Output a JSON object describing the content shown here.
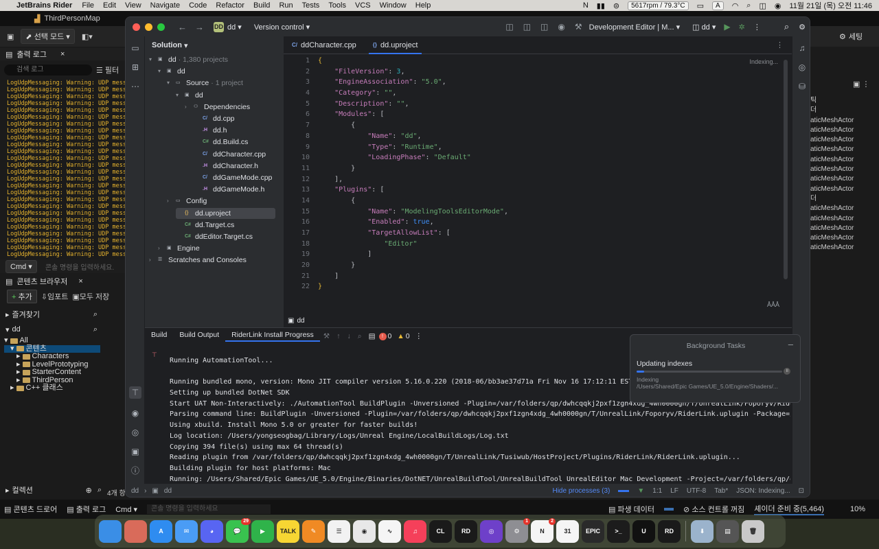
{
  "menubar": {
    "app": "JetBrains Rider",
    "items": [
      "File",
      "Edit",
      "View",
      "Navigate",
      "Code",
      "Refactor",
      "Build",
      "Run",
      "Tests",
      "Tools",
      "VCS",
      "Window",
      "Help"
    ],
    "status": "5617rpm / 79.3°C",
    "clock": "11월 21일 (목) 오전 11:46",
    "input_badge": "A"
  },
  "unreal": {
    "map_title": "ThirdPersonMap",
    "mode_button": "선택 모드",
    "output_log_tab": "출력 로그",
    "search_placeholder": "검색 로그",
    "filter_label": "필터",
    "log_line": "LogUdpMessaging: Warning: UDP mess",
    "cmd_label": "Cmd",
    "cmd_placeholder": "콘솔 명령을 입력하세요.",
    "content_browser_tab": "콘텐츠 브라우저",
    "add_button": "추가",
    "import_button": "임포트",
    "save_all_button": "모두 저장",
    "favorites_label": "즐겨찾기",
    "project_label": "dd",
    "tree": [
      {
        "label": "All",
        "depth": 0,
        "sel": false
      },
      {
        "label": "콘텐츠",
        "depth": 1,
        "sel": true
      },
      {
        "label": "Characters",
        "depth": 2,
        "sel": false
      },
      {
        "label": "LevelPrototyping",
        "depth": 2,
        "sel": false
      },
      {
        "label": "StarterContent",
        "depth": 2,
        "sel": false
      },
      {
        "label": "ThirdPerson",
        "depth": 2,
        "sel": false
      },
      {
        "label": "C++ 클래스",
        "depth": 1,
        "sel": false
      }
    ],
    "collections_label": "컬렉션",
    "items_count": "4개 항",
    "settings_label": "세팅",
    "right_items": [
      "틱",
      "더",
      "aticMeshActor",
      "aticMeshActor",
      "aticMeshActor",
      "aticMeshActor",
      "aticMeshActor",
      "aticMeshActor",
      "aticMeshActor",
      "aticMeshActor",
      "더",
      "aticMeshActor",
      "aticMeshActor",
      "aticMeshActor",
      "aticMeshActor",
      "aticMeshActor"
    ],
    "bottom_bar": {
      "content_drawer": "콘텐츠 드로어",
      "output_log": "출력 로그",
      "cmd": "Cmd",
      "cmd_placeholder": "콘솔 명령을 입력하세요",
      "derived_data": "파생 데이터",
      "source_control": "소스 컨트롤 꺼짐",
      "shader_status": "셰이더 준비 중(5,464)",
      "zoom": "10%"
    }
  },
  "rider": {
    "project_badge": "DD",
    "project_name": "dd",
    "vcs_label": "Version control",
    "run_config": "Development Editor | M...",
    "run_target": "dd",
    "solution_header": "Solution",
    "tree": [
      {
        "label": "dd",
        "muted": "· 1,380 projects",
        "depth": 0,
        "arrow": "▾",
        "icon": "▣",
        "sel": false
      },
      {
        "label": "dd",
        "muted": "",
        "depth": 1,
        "arrow": "▾",
        "icon": "▣",
        "sel": false
      },
      {
        "label": "Source",
        "muted": "· 1 project",
        "depth": 2,
        "arrow": "▾",
        "icon": "▭",
        "sel": false
      },
      {
        "label": "dd",
        "muted": "",
        "depth": 3,
        "arrow": "▾",
        "icon": "▣",
        "sel": false
      },
      {
        "label": "Dependencies",
        "muted": "",
        "depth": 4,
        "arrow": "›",
        "icon": "⚇",
        "sel": false
      },
      {
        "label": "dd.cpp",
        "muted": "",
        "depth": 5,
        "arrow": "",
        "icon": "C/",
        "sel": false
      },
      {
        "label": "dd.h",
        "muted": "",
        "depth": 5,
        "arrow": "",
        "icon": ".H",
        "sel": false
      },
      {
        "label": "dd.Build.cs",
        "muted": "",
        "depth": 5,
        "arrow": "",
        "icon": "C#",
        "sel": false
      },
      {
        "label": "ddCharacter.cpp",
        "muted": "",
        "depth": 5,
        "arrow": "",
        "icon": "C/",
        "sel": false
      },
      {
        "label": "ddCharacter.h",
        "muted": "",
        "depth": 5,
        "arrow": "",
        "icon": ".H",
        "sel": false
      },
      {
        "label": "ddGameMode.cpp",
        "muted": "",
        "depth": 5,
        "arrow": "",
        "icon": "C/",
        "sel": false
      },
      {
        "label": "ddGameMode.h",
        "muted": "",
        "depth": 5,
        "arrow": "",
        "icon": ".H",
        "sel": false
      },
      {
        "label": "Config",
        "muted": "",
        "depth": 2,
        "arrow": "›",
        "icon": "▭",
        "sel": false
      },
      {
        "label": "dd.uproject",
        "muted": "",
        "depth": 3,
        "arrow": "",
        "icon": "{}",
        "sel": true
      },
      {
        "label": "dd.Target.cs",
        "muted": "",
        "depth": 3,
        "arrow": "",
        "icon": "C#",
        "sel": false
      },
      {
        "label": "ddEditor.Target.cs",
        "muted": "",
        "depth": 3,
        "arrow": "",
        "icon": "C#",
        "sel": false
      },
      {
        "label": "Engine",
        "muted": "",
        "depth": 1,
        "arrow": "›",
        "icon": "▣",
        "sel": false
      },
      {
        "label": "Scratches and Consoles",
        "muted": "",
        "depth": 0,
        "arrow": "›",
        "icon": "☰",
        "sel": false
      }
    ],
    "tabs": [
      {
        "label": "ddCharacter.cpp",
        "icon": "C/",
        "active": false
      },
      {
        "label": "dd.uproject",
        "icon": "{}",
        "active": true
      }
    ],
    "indexing_label": "Indexing...",
    "code_lines": [
      "{",
      "    <k>\"FileVersion\"</k>: <n>3</n>,",
      "    <k>\"EngineAssociation\"</k>: <s>\"5.0\"</s>,",
      "    <k>\"Category\"</k>: <s>\"\"</s>,",
      "    <k>\"Description\"</k>: <s>\"\"</s>,",
      "    <k>\"Modules\"</k>: [",
      "        {",
      "            <k>\"Name\"</k>: <s>\"dd\"</s>,",
      "            <k>\"Type\"</k>: <s>\"Runtime\"</s>,",
      "            <k>\"LoadingPhase\"</k>: <s>\"Default\"</s>",
      "        }",
      "    ],",
      "    <k>\"Plugins\"</k>: [",
      "        {",
      "            <k>\"Name\"</k>: <s>\"ModelingToolsEditorMode\"</s>,",
      "            <k>\"Enabled\"</k>: <b>true</b>,",
      "            <k>\"TargetAllowList\"</k>: [",
      "                <s>\"Editor\"</s>",
      "            ]",
      "        }",
      "    ]",
      "}"
    ],
    "breadcrumb": "dd",
    "bottom_tabs": [
      "Build",
      "Build Output",
      "RiderLink Install Progress"
    ],
    "active_bottom_tab": 2,
    "error_count": "0",
    "warning_count": "0",
    "output_lines": [
      "Running AutomationTool...",
      "",
      "Running bundled mono, version: Mono JIT compiler version 5.16.0.220 (2018-06/bb3ae37d71a Fri Nov 16 17:12:11 EST 2018)",
      "Setting up bundled DotNet SDK",
      "Start UAT Non-Interactively: ./AutomationTool BuildPlugin -Unversioned -Plugin=/var/folders/qp/dwhcqqkj2pxf1zgn4xdg_4wh0000gn/T/UnrealLink/Foporyv/RiderLink.uplugin",
      "Parsing command line: BuildPlugin -Unversioned -Plugin=/var/folders/qp/dwhcqqkj2pxf1zgn4xdg_4wh0000gn/T/UnrealLink/Foporyv/RiderLink.uplugin -Package=/var/folders/",
      "Using xbuild. Install Mono 5.0 or greater for faster builds!",
      "Log location: /Users/yongseogbag/Library/Logs/Unreal Engine/LocalBuildLogs/Log.txt",
      "Copying 394 file(s) using max 64 thread(s)",
      "Reading plugin from /var/folders/qp/dwhcqqkj2pxf1zgn4xdg_4wh0000gn/T/UnrealLink/Tusiwub/HostProject/Plugins/RiderLink/RiderLink.uplugin...",
      "Building plugin for host platforms: Mac",
      "Running: /Users/Shared/Epic Games/UE_5.0/Engine/Binaries/DotNET/UnrealBuildTool/UnrealBuildTool UnrealEditor Mac Development -Project=/var/folders/qp/dwhcqqkj2pxf1"
    ],
    "bg_tasks": {
      "header": "Background Tasks",
      "task": "Updating indexes",
      "progress": 0.05,
      "sub_line1": "Indexing",
      "sub_line2": "/Users/Shared/Epic Games/UE_5.0/Engine/Shaders/..."
    },
    "status": {
      "path_root": "dd",
      "path_leaf": "dd",
      "hide_processes": "Hide processes (3)",
      "position": "1:1",
      "line_sep": "LF",
      "encoding": "UTF-8",
      "indent": "Tab*",
      "lang": "JSON: Indexing..."
    }
  },
  "dock": [
    {
      "name": "finder",
      "label": "",
      "color": "#3a8ee6",
      "badge": ""
    },
    {
      "name": "launchpad",
      "label": "",
      "color": "#d96b5a",
      "badge": ""
    },
    {
      "name": "app-store",
      "label": "A",
      "color": "#2f8cf0",
      "badge": ""
    },
    {
      "name": "mail",
      "label": "✉",
      "color": "#4a9cf5",
      "badge": ""
    },
    {
      "name": "discord",
      "label": "◕",
      "color": "#5865f2",
      "badge": ""
    },
    {
      "name": "messages",
      "label": "💬",
      "color": "#39c24f",
      "badge": "29"
    },
    {
      "name": "facetime",
      "label": "▶",
      "color": "#2fb34a",
      "badge": ""
    },
    {
      "name": "kakaotalk",
      "label": "TALK",
      "color": "#f7d633",
      "badge": ""
    },
    {
      "name": "pages",
      "label": "✎",
      "color": "#f08a24",
      "badge": ""
    },
    {
      "name": "reminders",
      "label": "☰",
      "color": "#f2f2f2",
      "badge": ""
    },
    {
      "name": "chrome",
      "label": "◉",
      "color": "#e8e8e8",
      "badge": ""
    },
    {
      "name": "freeform",
      "label": "∿",
      "color": "#f5f5f5",
      "badge": ""
    },
    {
      "name": "music",
      "label": "♫",
      "color": "#f5405a",
      "badge": ""
    },
    {
      "name": "clion",
      "label": "CL",
      "color": "#1a1a1a",
      "badge": ""
    },
    {
      "name": "rider",
      "label": "RD",
      "color": "#1a1a1a",
      "badge": ""
    },
    {
      "name": "github",
      "label": "◎",
      "color": "#6e40c9",
      "badge": ""
    },
    {
      "name": "settings",
      "label": "⚙",
      "color": "#8e8e93",
      "badge": "1"
    },
    {
      "name": "notion",
      "label": "N",
      "color": "#f5f5f5",
      "badge": "2"
    },
    {
      "name": "calendar",
      "label": "31",
      "color": "#f5f5f5",
      "badge": ""
    },
    {
      "name": "epic-games",
      "label": "EPIC",
      "color": "#2a2a2a",
      "badge": ""
    },
    {
      "name": "terminal",
      "label": ">_",
      "color": "#1c1c1c",
      "badge": ""
    },
    {
      "name": "unreal",
      "label": "U",
      "color": "#111",
      "badge": ""
    },
    {
      "name": "rider-2",
      "label": "RD",
      "color": "#1a1a1a",
      "badge": ""
    },
    {
      "name": "downloads",
      "label": "⬇",
      "color": "#9bb3cc",
      "badge": ""
    },
    {
      "name": "desktop-stack",
      "label": "▤",
      "color": "#555",
      "badge": ""
    },
    {
      "name": "trash",
      "label": "🗑",
      "color": "#c9c9c9",
      "badge": ""
    }
  ]
}
